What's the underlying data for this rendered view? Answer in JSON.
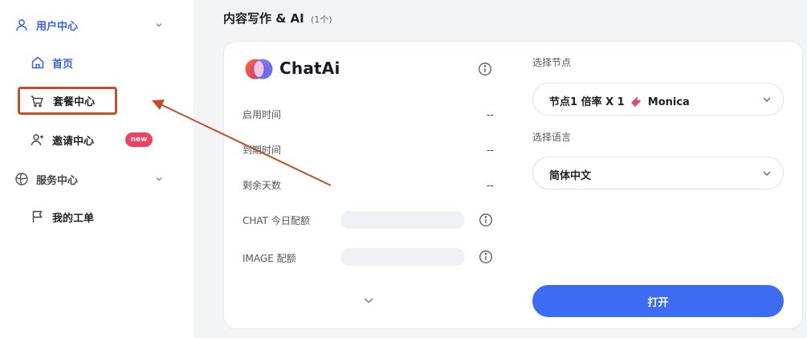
{
  "sidebar": {
    "groups": [
      {
        "label": "用户中心",
        "icon": "user-icon",
        "color": "#3b63e6"
      },
      {
        "label": "服务中心",
        "icon": "service-icon"
      }
    ],
    "items": [
      {
        "label": "首页",
        "icon": "home-icon"
      },
      {
        "label": "套餐中心",
        "icon": "cart-icon"
      },
      {
        "label": "邀请中心",
        "icon": "invite-user-icon",
        "badge": "new"
      },
      {
        "label": "我的工单",
        "icon": "flag-icon"
      }
    ]
  },
  "main": {
    "title": "内容写作 & AI",
    "count": "(1个)",
    "product": {
      "name": "ChatAi",
      "logo_icon": "chatai-logo-icon"
    },
    "rows": [
      {
        "label": "启用时间",
        "value": "--"
      },
      {
        "label": "到期时间",
        "value": "--"
      },
      {
        "label": "剩余天数",
        "value": "--"
      },
      {
        "label": "CHAT 今日配额"
      },
      {
        "label": "IMAGE 配额"
      }
    ],
    "node": {
      "label": "选择节点",
      "value_prefix": "节点1 倍率 X 1",
      "value_suffix": "Monica"
    },
    "language": {
      "label": "选择语言",
      "value": "简体中文"
    },
    "open_button": "打开"
  },
  "colors": {
    "accent": "#3d6bf2",
    "annotation": "#c0502a",
    "badge": "#ef4160"
  }
}
